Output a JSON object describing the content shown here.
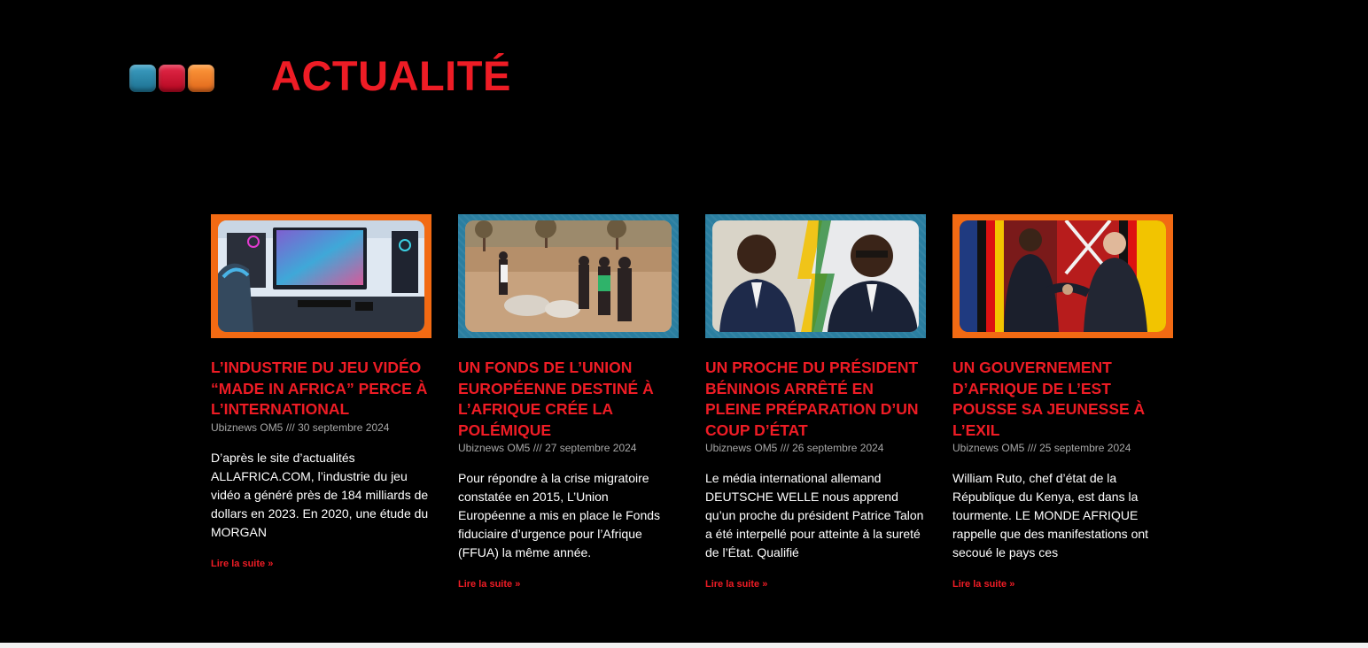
{
  "section": {
    "title": "ACTUALITÉ",
    "accent_color": "#ee1c25",
    "dots": [
      "#1c6f8f",
      "#b3061f",
      "#e0661a"
    ]
  },
  "articles": [
    {
      "title": "L’INDUSTRIE DU JEU VIDÉO “MADE IN AFRICA” PERCE À L’INTERNATIONAL",
      "author": "Ubiznews OM5",
      "separator": "///",
      "date": "30 septembre 2024",
      "excerpt": "D’après le site d’actualités ALLAFRICA.COM, l’industrie du jeu vidéo a généré près de 184 milliards de dollars en 2023. En 2020, une étude du MORGAN",
      "read_more": "Lire la suite »",
      "frame_color": "#f26a13",
      "image_icon": "gaming-setup-image"
    },
    {
      "title": "UN FONDS DE L’UNION EUROPÉENNE DESTINÉ À L’AFRIQUE CRÉE LA POLÉMIQUE",
      "author": "Ubiznews OM5",
      "separator": "///",
      "date": "27 septembre 2024",
      "excerpt": "Pour répondre à la crise migratoire constatée en 2015, L’Union Européenne a mis en place le Fonds fiduciaire d’urgence pour l’Afrique (FFUA) la même année.",
      "read_more": "Lire la suite »",
      "frame_color": "#2a7ea0",
      "image_icon": "migrants-riverbank-image"
    },
    {
      "title": "UN PROCHE DU PRÉSIDENT BÉNINOIS ARRÊTÉ EN PLEINE PRÉPARATION D’UN COUP D’ÉTAT",
      "author": "Ubiznews OM5",
      "separator": "///",
      "date": "26 septembre 2024",
      "excerpt": "Le média international allemand DEUTSCHE WELLE nous apprend qu’un proche du président Patrice Talon a été interpellé pour atteinte à la sureté de l’État. Qualifié",
      "read_more": "Lire la suite »",
      "frame_color": "#2a7ea0",
      "image_icon": "two-politicians-portrait-image"
    },
    {
      "title": "UN GOUVERNEMENT D’AFRIQUE DE L’EST POUSSE SA JEUNESSE À L’EXIL",
      "author": "Ubiznews OM5",
      "separator": "///",
      "date": "25 septembre 2024",
      "excerpt": "William Ruto, chef d’état de la République du Kenya, est dans la tourmente. LE MONDE AFRIQUE rappelle que des manifestations ont secoué le pays ces",
      "read_more": "Lire la suite »",
      "frame_color": "#f26a13",
      "image_icon": "handshake-leaders-image"
    }
  ]
}
